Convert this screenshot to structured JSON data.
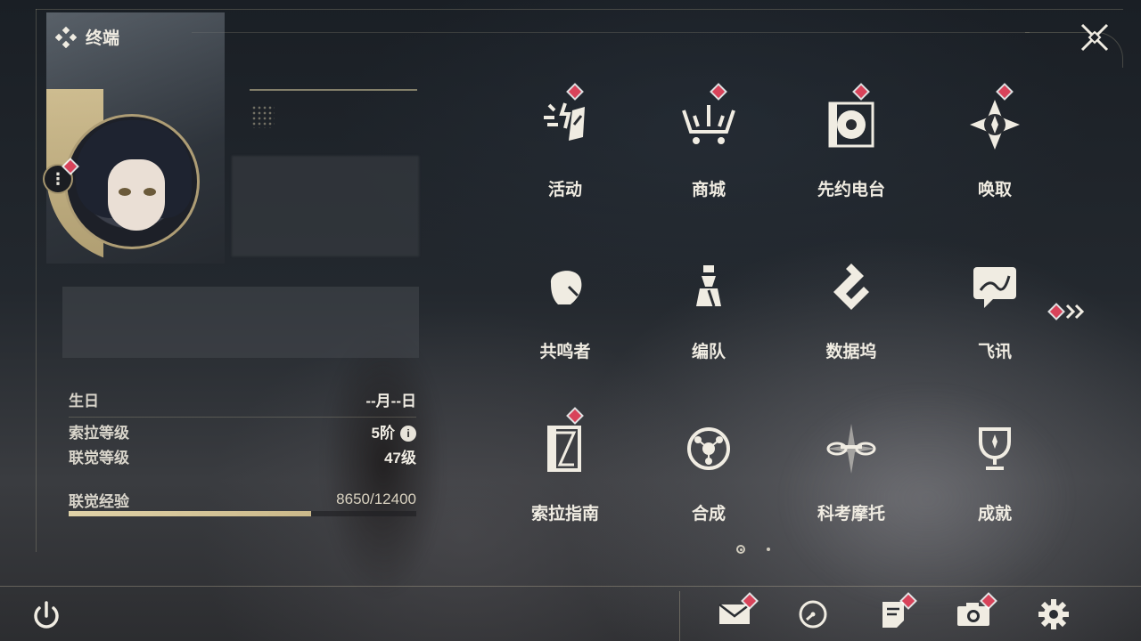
{
  "header": {
    "title": "终端"
  },
  "profile": {
    "birthday_label": "生日",
    "birthday_value": "--月--日",
    "sola_level_label": "索拉等级",
    "sola_level_value": "5阶",
    "union_level_label": "联觉等级",
    "union_level_value": "47级",
    "union_exp_label": "联觉经验",
    "union_exp_value": "8650/12400",
    "union_exp_progress": 0.6976
  },
  "menu": {
    "items": [
      {
        "label": "活动",
        "icon": "activity-icon",
        "badge": true
      },
      {
        "label": "商城",
        "icon": "shop-cart-icon",
        "badge": true
      },
      {
        "label": "先约电台",
        "icon": "radio-icon",
        "badge": true
      },
      {
        "label": "唤取",
        "icon": "convene-compass-icon",
        "badge": true
      },
      {
        "label": "共鸣者",
        "icon": "resonator-icon",
        "badge": false
      },
      {
        "label": "编队",
        "icon": "team-chess-icon",
        "badge": false
      },
      {
        "label": "数据坞",
        "icon": "databank-icon",
        "badge": false
      },
      {
        "label": "飞讯",
        "icon": "chat-icon",
        "badge": false
      },
      {
        "label": "索拉指南",
        "icon": "guidebook-icon",
        "badge": true
      },
      {
        "label": "合成",
        "icon": "synthesis-icon",
        "badge": false
      },
      {
        "label": "科考摩托",
        "icon": "motorbike-icon",
        "badge": false
      },
      {
        "label": "成就",
        "icon": "trophy-icon",
        "badge": false
      }
    ],
    "page_current": 1,
    "page_total": 2
  },
  "bottom_bar": [
    "mail-icon",
    "clock-icon",
    "notes-icon",
    "camera-icon",
    "settings-gear-icon"
  ],
  "colors": {
    "accent_gold": "#cbb98a",
    "badge_red": "#d8435a",
    "text": "#f0ece2"
  }
}
